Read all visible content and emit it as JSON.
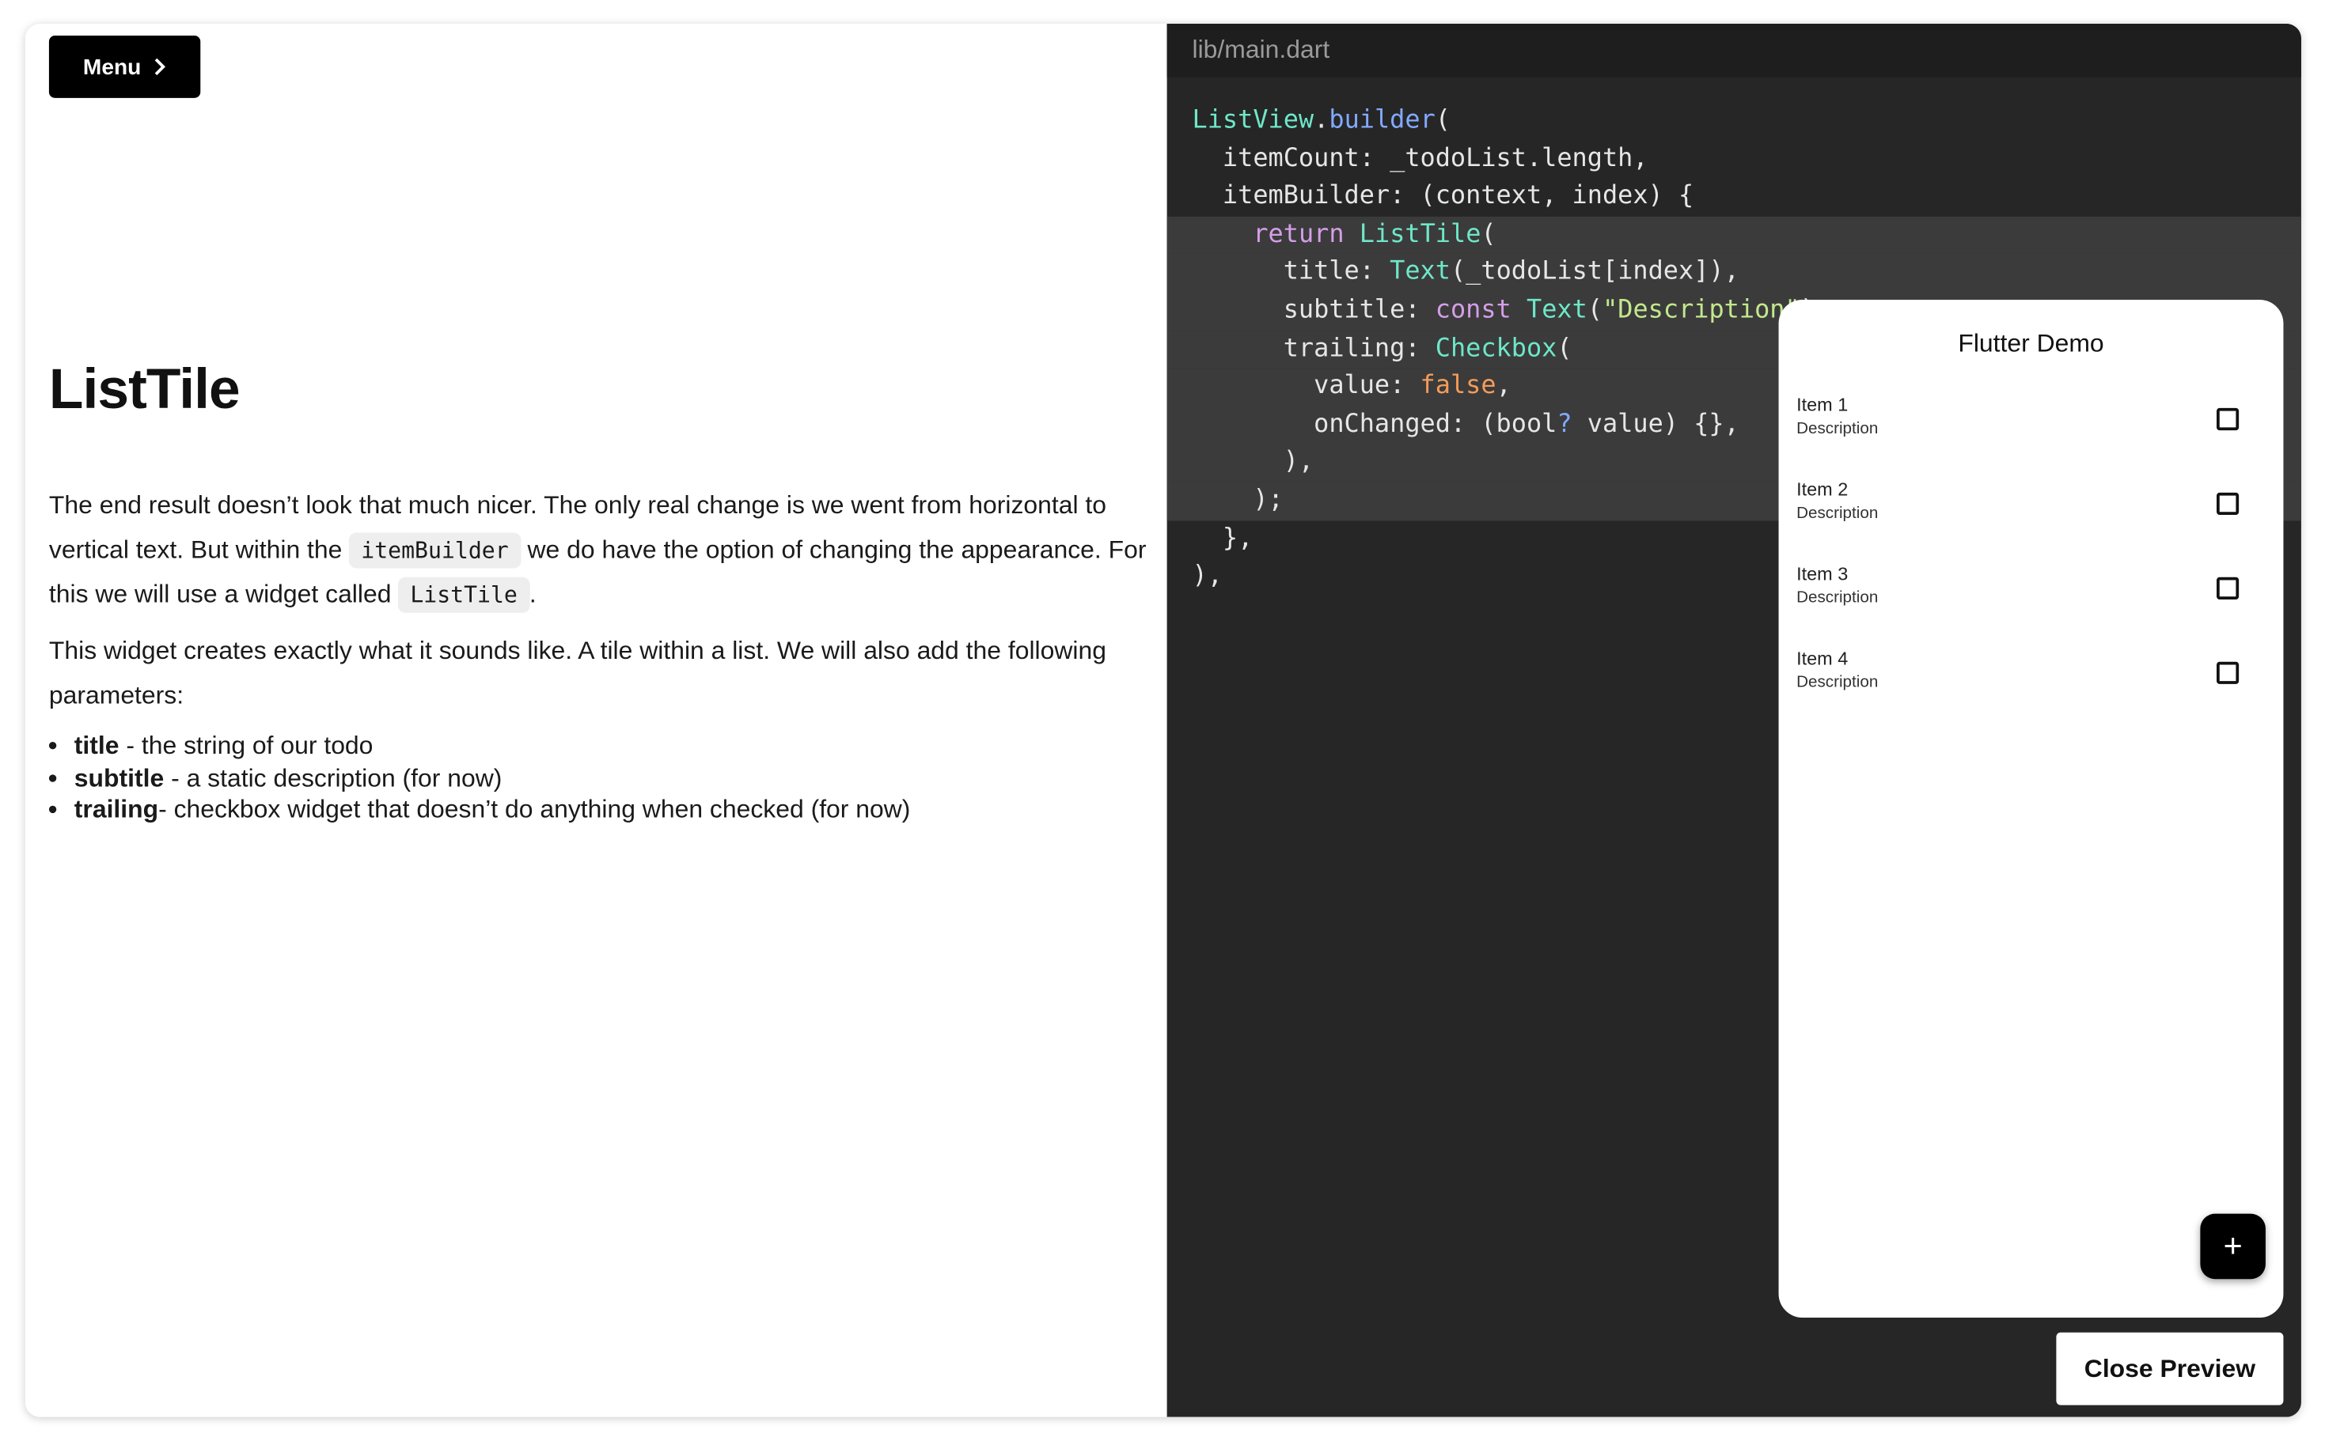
{
  "left": {
    "menu_label": "Menu",
    "heading": "ListTile",
    "para1": {
      "t1": "The end result doesn’t look that much nicer. The only real change is we went from horizontal to vertical text. But within the ",
      "code1": "itemBuilder",
      "t2": " we do have the option of changing the appearance. For this we will use a widget called ",
      "code2": "ListTile",
      "t3": "."
    },
    "para2": "This widget creates exactly what it sounds like. A tile within a list. We will also add the following parameters:",
    "bullets": [
      {
        "term": "title",
        "text": " - the string of our todo"
      },
      {
        "term": "subtitle",
        "text": " - a static description (for now)"
      },
      {
        "term": "trailing",
        "text": "- checkbox widget that doesn’t do anything when checked (for now)"
      }
    ]
  },
  "editor": {
    "filename": "lib/main.dart",
    "colors": {
      "type": "#6ee7c8",
      "method": "#82aaff",
      "keyword": "#d49ee8",
      "literal": "#f39c5a",
      "string": "#c3e88d",
      "plain": "#e6e6e6"
    },
    "lines": [
      {
        "hl": false,
        "segs": [
          [
            "ListView",
            "type"
          ],
          [
            ".",
            "plain"
          ],
          [
            "builder",
            "method"
          ],
          [
            "(",
            "plain"
          ]
        ]
      },
      {
        "hl": false,
        "segs": [
          [
            "  itemCount: _todoList.length,",
            "plain"
          ]
        ]
      },
      {
        "hl": false,
        "segs": [
          [
            "  itemBuilder: (context, index) {",
            "plain"
          ]
        ]
      },
      {
        "hl": true,
        "segs": [
          [
            "    ",
            "plain"
          ],
          [
            "return",
            "keyword"
          ],
          [
            " ",
            "plain"
          ],
          [
            "ListTile",
            "type"
          ],
          [
            "(",
            "plain"
          ]
        ]
      },
      {
        "hl": true,
        "segs": [
          [
            "      title: ",
            "plain"
          ],
          [
            "Text",
            "type"
          ],
          [
            "(_todoList[index]),",
            "plain"
          ]
        ]
      },
      {
        "hl": true,
        "segs": [
          [
            "      subtitle: ",
            "plain"
          ],
          [
            "const",
            "keyword"
          ],
          [
            " ",
            "plain"
          ],
          [
            "Text",
            "type"
          ],
          [
            "(",
            "plain"
          ],
          [
            "\"Description\"",
            "string"
          ],
          [
            "),",
            "plain"
          ]
        ]
      },
      {
        "hl": true,
        "segs": [
          [
            "      trailing: ",
            "plain"
          ],
          [
            "Checkbox",
            "type"
          ],
          [
            "(",
            "plain"
          ]
        ]
      },
      {
        "hl": true,
        "segs": [
          [
            "        value: ",
            "plain"
          ],
          [
            "false",
            "literal"
          ],
          [
            ",",
            "plain"
          ]
        ]
      },
      {
        "hl": true,
        "segs": [
          [
            "        onChanged: (bool",
            "plain"
          ],
          [
            "?",
            "method"
          ],
          [
            " value) {},",
            "plain"
          ]
        ]
      },
      {
        "hl": true,
        "segs": [
          [
            "      ),",
            "plain"
          ]
        ]
      },
      {
        "hl": true,
        "segs": [
          [
            "    );",
            "plain"
          ]
        ]
      },
      {
        "hl": false,
        "segs": [
          [
            "  },",
            "plain"
          ]
        ]
      },
      {
        "hl": false,
        "segs": [
          [
            "),",
            "plain"
          ]
        ]
      }
    ]
  },
  "preview": {
    "title": "Flutter Demo",
    "items": [
      {
        "title": "Item 1",
        "subtitle": "Description",
        "checked": false
      },
      {
        "title": "Item 2",
        "subtitle": "Description",
        "checked": false
      },
      {
        "title": "Item 3",
        "subtitle": "Description",
        "checked": false
      },
      {
        "title": "Item 4",
        "subtitle": "Description",
        "checked": false
      }
    ],
    "fab_icon": "plus-icon",
    "fab_label": "+"
  },
  "close_preview_label": "Close Preview"
}
